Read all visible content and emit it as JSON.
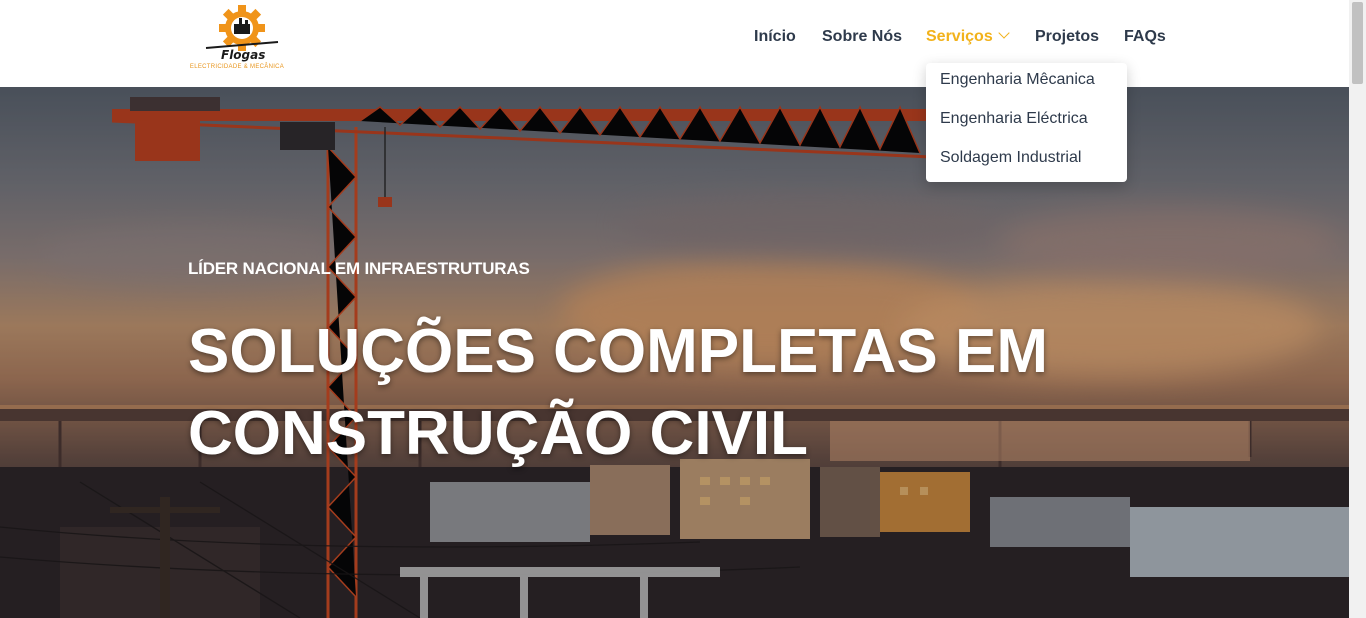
{
  "brand": {
    "name": "Flogas",
    "tagline": "ELECTRICIDADE & MECÂNICA",
    "logo_icon": "gear-crane-logo",
    "accent_color": "#f2b21b"
  },
  "nav": {
    "items": [
      {
        "label": "Início"
      },
      {
        "label": "Sobre Nós"
      },
      {
        "label": "Serviços",
        "active": true
      },
      {
        "label": "Projetos"
      },
      {
        "label": "FAQs"
      }
    ],
    "dropdown_icon": "chevron-down-icon"
  },
  "services_dropdown": {
    "items": [
      {
        "label": "Engenharia Mêcanica"
      },
      {
        "label": "Engenharia Eléctrica"
      },
      {
        "label": "Soldagem Industrial"
      }
    ]
  },
  "hero": {
    "kicker": "LÍDER NACIONAL EM INFRAESTRUTURAS",
    "title_line1": "SOLUÇÕES COMPLETAS EM",
    "title_line2": "CONSTRUÇÃO CIVIL",
    "background": "construction-crane-sunset-photo"
  }
}
